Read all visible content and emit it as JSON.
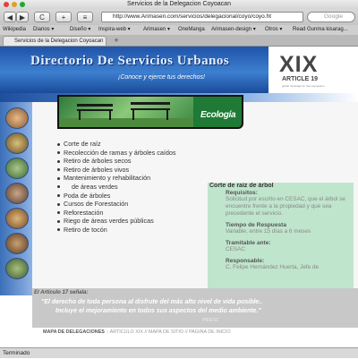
{
  "window": {
    "title": "Servicios de la Delegacion Coyoacan"
  },
  "toolbar": {
    "back_label": "◀",
    "forward_label": "▶",
    "reload_label": "C",
    "add_label": "+",
    "url": "http://www.Arimasen.com/servicios/delegacional/coyo/coyo.ht",
    "search_placeholder": "Google"
  },
  "bookmarks": [
    "Wikipedia",
    "Diarios ▾",
    "Diseño ▾",
    "Inspira-web ▾",
    "Arimasen ▾",
    "OneManga",
    "Arimasen-design ▾",
    "Otros ▾",
    "Read Gunma kisarag..."
  ],
  "tab": {
    "label": "Servicios de la Delegacion Coyoacan",
    "new_tab": "+"
  },
  "banner": {
    "title": "Directorio De Servicios Urbanos",
    "subtitle": "¡Conoce y ejerce tus derechos!",
    "logo_main": "XIX",
    "logo_sub": "ARTICLE 19",
    "logo_tag": "global campaign for free expression"
  },
  "section": {
    "title": "Ecología"
  },
  "services": [
    "Corte de raíz",
    "Recolección de ramas y árboles caídos",
    "Retiro de árboles secos",
    "Retiro de árboles vivos",
    "Mantenimiento y rehabilitación",
    "de áreas verdes",
    "Poda de árboles",
    "Cursos de Forestación",
    "Reforestación",
    "Riego de áreas verdes públicas",
    "Retiro de tocón"
  ],
  "detail": {
    "title": "Corte de raíz de árbol",
    "requisitos_label": "Requisitos:",
    "requisitos_text": "Solicitud por escrito en CESAC, que el árbol se encuentre frente a la propiedad y que sea precedente el servicio.",
    "tiempo_label": "Tiempo de Respuesta",
    "tiempo_text": "Variable, entre 15 días a 6 meses",
    "tramitable_label": "Tramitable ante:",
    "tramitable_text": "CESAC",
    "responsable_label": "Responsable:",
    "responsable_text": "C. Felipe Hernández Huerta, Jefe de"
  },
  "quote": {
    "heading": "El Artículo 17 señala:",
    "line1": "\"El derecho de toda persona al disfrute del más alto nivel de vida posible..",
    "line2": "Incluye el mejoramiento en todos sus aspectos del medio ambiente.\"",
    "signature": "PIDESC"
  },
  "footer": {
    "link1": "MAPA DE DELEGACIONES",
    "sep1": "::",
    "link2": "ARTICULO XIX",
    "sep2": "//",
    "link3": "MAPA DE SITIO",
    "sep3": "//",
    "link4": "PAGINA DE INICIO"
  },
  "status": {
    "text": "Terminado"
  },
  "colors": {
    "banner": "#2a63b8",
    "heading": "#1e7a34",
    "detail_bg": "#bfe5cc",
    "quote_bg": "#c8c8c8"
  }
}
